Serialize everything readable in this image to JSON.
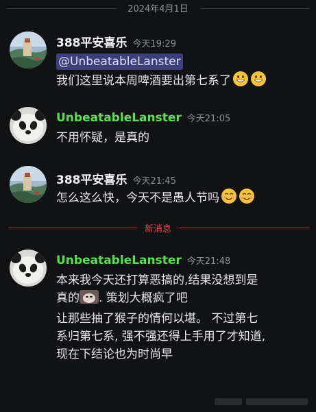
{
  "date_divider": "2024年4月1日",
  "new_messages_label": "新消息",
  "messages": [
    {
      "username": "388平安喜乐",
      "timestamp": "今天19:29",
      "mention": "@UnbeatableLanster",
      "text": "我们这里说本周啤酒要出第七系了",
      "emoji": "grinning-face-emoji"
    },
    {
      "username": "UnbeatableLanster",
      "timestamp": "今天21:05",
      "text": "不用怀疑，是真的"
    },
    {
      "username": "388平安喜乐",
      "timestamp": "今天21:45",
      "text": "怎么这么快，今天不是愚人节吗",
      "emoji": "smiling-face-with-blush-emoji"
    },
    {
      "username": "UnbeatableLanster",
      "timestamp": "今天21:48",
      "line1": "本来我今天还打算恶搞的,结果没想到是",
      "line2a": "真的",
      "line2b": ". 策划大概疯了吧",
      "para2_line1": "让那些抽了猴子的情何以堪。 不过第七",
      "para2_line2": "系归第七系, 强不强还得上手用了才知道,",
      "para2_line3": "现在下结论也为时尚早"
    }
  ],
  "colors": {
    "background": "#111214",
    "username_green": "#57e34c",
    "new_divider_red": "#f23f43",
    "mention_bg": "#3d3f7a"
  }
}
